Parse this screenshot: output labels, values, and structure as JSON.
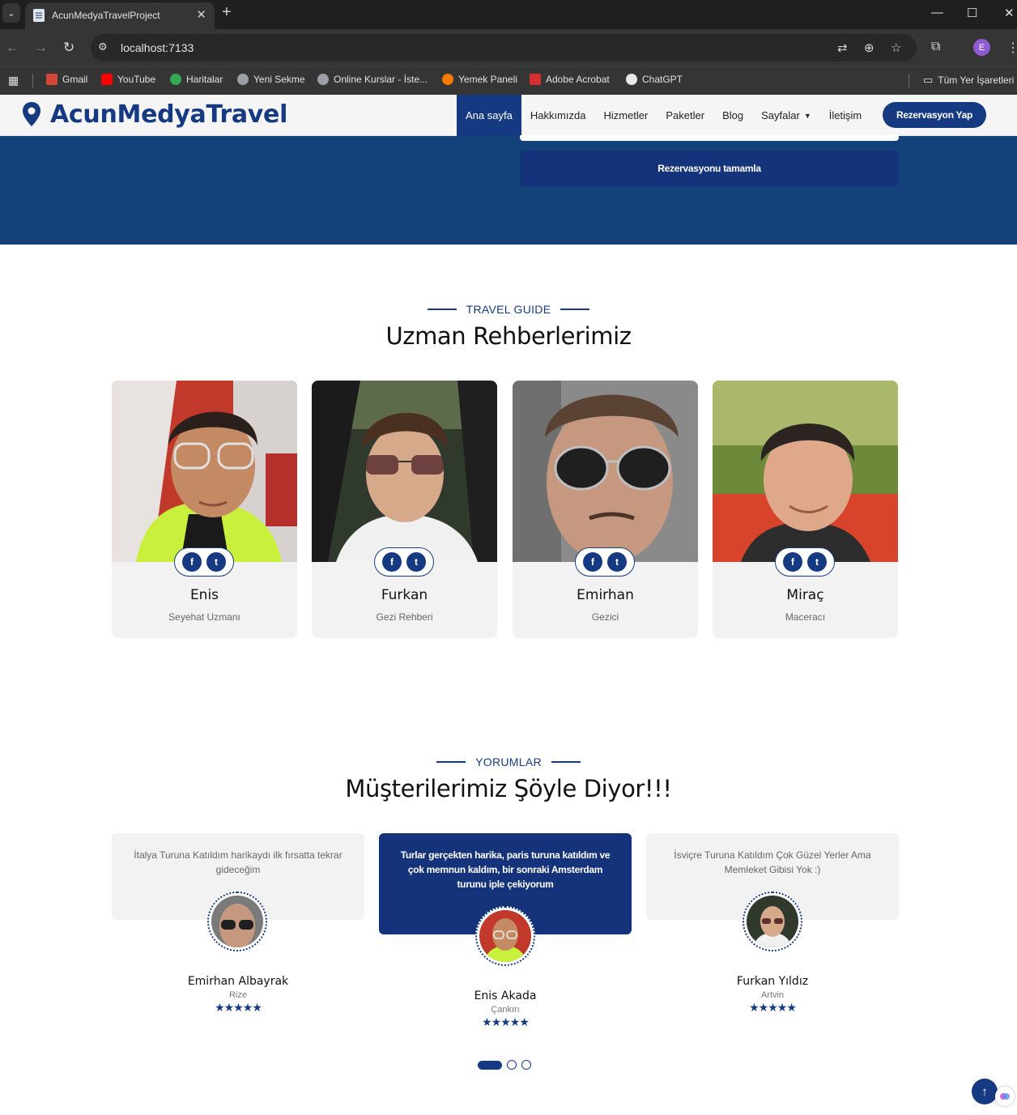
{
  "browser": {
    "tab_title": "AcunMedyaTravelProject",
    "url": "localhost:7133",
    "bookmarks": [
      "Gmail",
      "YouTube",
      "Haritalar",
      "Yeni Sekme",
      "Online Kurslar - İste...",
      "Yemek Paneli",
      "Adobe Acrobat",
      "ChatGPT"
    ],
    "all_bookmarks": "Tüm Yer İşaretleri",
    "profile_initial": "E"
  },
  "site": {
    "logo": "AcunMedyaTravel",
    "nav": [
      "Ana sayfa",
      "Hakkımızda",
      "Hizmetler",
      "Paketler",
      "Blog",
      "Sayfalar",
      "İletişim"
    ],
    "cta": "Rezervasyon Yap",
    "brand_color": "#163a82"
  },
  "booking": {
    "submit_label": "Rezervasyonu tamamla"
  },
  "guides": {
    "eyebrow": "TRAVEL GUIDE",
    "title": "Uzman Rehberlerimiz",
    "items": [
      {
        "name": "Enis",
        "role": "Seyehat Uzmanı"
      },
      {
        "name": "Furkan",
        "role": "Gezi Rehberi"
      },
      {
        "name": "Emirhan",
        "role": "Gezici"
      },
      {
        "name": "Miraç",
        "role": "Maceracı"
      }
    ]
  },
  "testimonials": {
    "eyebrow": "YORUMLAR",
    "title": "Müşterilerimiz Şöyle Diyor!!!",
    "items": [
      {
        "text": "İtalya Turuna Katıldım harikaydı ilk fırsatta tekrar gideceğim",
        "name": "Emirhan Albayrak",
        "city": "Rize",
        "stars": "★★★★★"
      },
      {
        "text": "Turlar gerçekten harika, paris turuna katıldım ve çok memnun kaldım, bir sonraki Amsterdam turunu iple çekiyorum",
        "name": "Enis Akada",
        "city": "Çankırı",
        "stars": "★★★★★"
      },
      {
        "text": "İsviçre Turuna Katıldım Çok Güzel Yerler Ama Memleket Gibisi Yok :)",
        "name": "Furkan Yıldız",
        "city": "Artvin",
        "stars": "★★★★★"
      }
    ]
  }
}
